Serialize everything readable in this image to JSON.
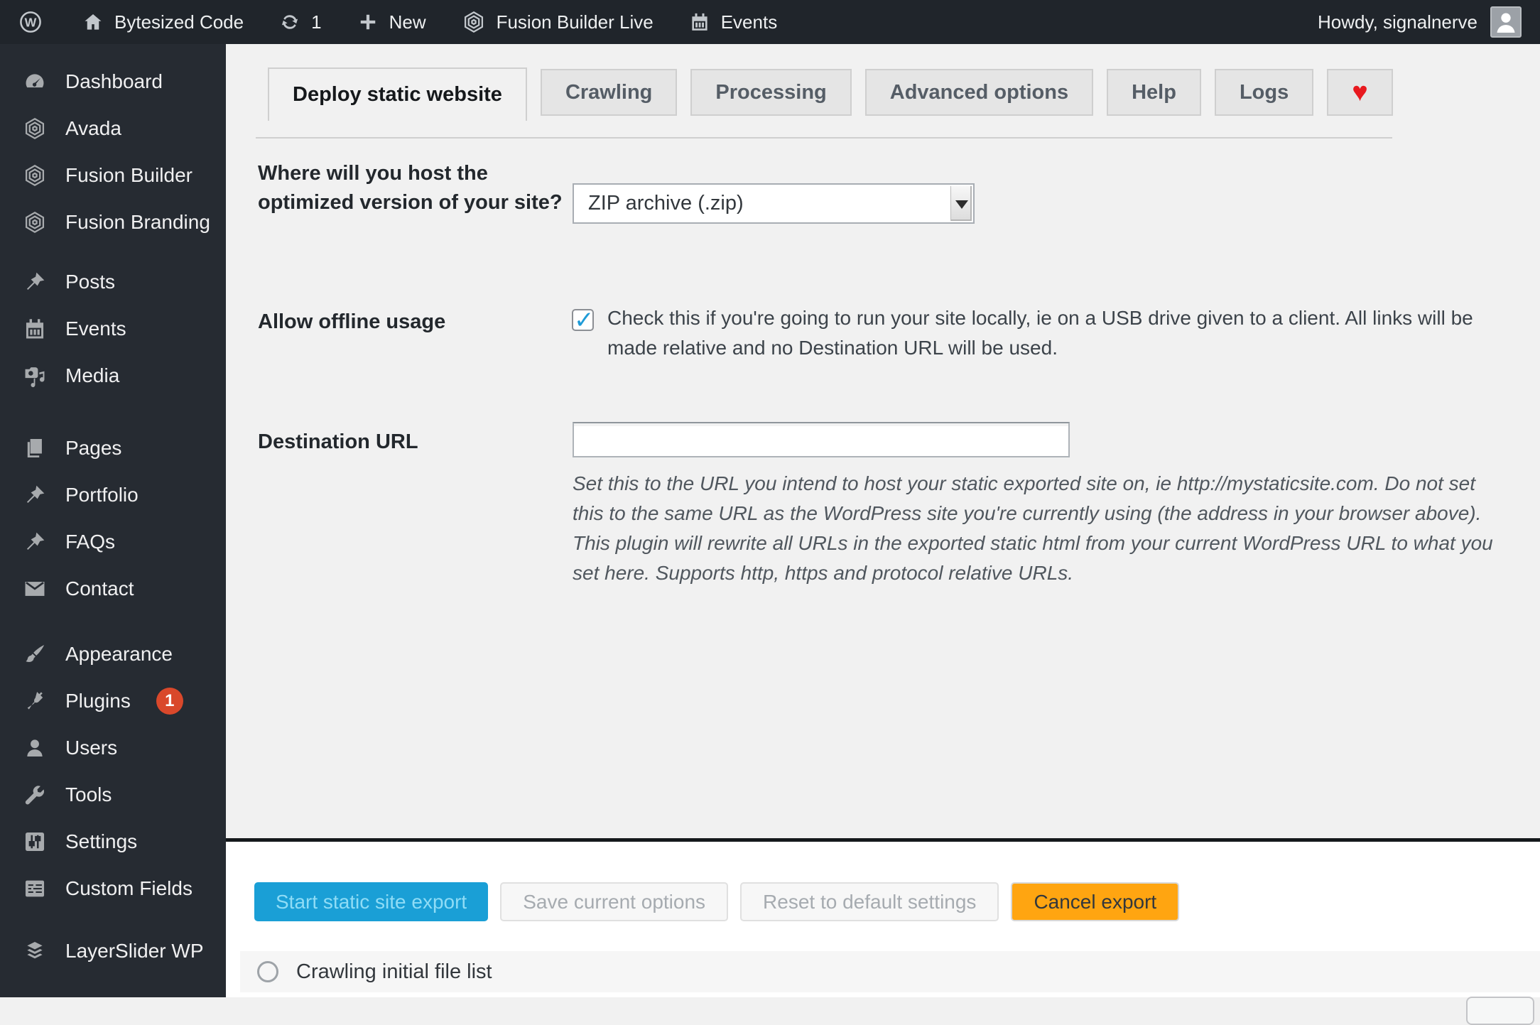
{
  "admin_bar": {
    "site_name": "Bytesized Code",
    "update_count": "1",
    "new_label": "New",
    "fusion_builder_live_label": "Fusion Builder Live",
    "events_label": "Events",
    "howdy": "Howdy, signalnerve"
  },
  "sidebar": {
    "items": [
      {
        "label": "Dashboard"
      },
      {
        "label": "Avada"
      },
      {
        "label": "Fusion Builder"
      },
      {
        "label": "Fusion Branding"
      },
      {
        "label": "Posts"
      },
      {
        "label": "Events"
      },
      {
        "label": "Media"
      },
      {
        "label": "Pages"
      },
      {
        "label": "Portfolio"
      },
      {
        "label": "FAQs"
      },
      {
        "label": "Contact"
      },
      {
        "label": "Appearance"
      },
      {
        "label": "Plugins",
        "badge": "1"
      },
      {
        "label": "Users"
      },
      {
        "label": "Tools"
      },
      {
        "label": "Settings"
      },
      {
        "label": "Custom Fields"
      },
      {
        "label": "LayerSlider WP"
      }
    ]
  },
  "tabs": {
    "deploy": "Deploy static website",
    "crawling": "Crawling",
    "processing": "Processing",
    "advanced": "Advanced options",
    "help": "Help",
    "logs": "Logs",
    "heart": "♥"
  },
  "form": {
    "host_question": {
      "label": "Where will you host the optimized version of your site?",
      "selected_option": "ZIP archive (.zip)"
    },
    "offline": {
      "label": "Allow offline usage",
      "checked": true,
      "description": "Check this if you're going to run your site locally, ie on a USB drive given to a client. All links will be made relative and no Destination URL will be used."
    },
    "destination": {
      "label": "Destination URL",
      "value": "",
      "description": "Set this to the URL you intend to host your static exported site on, ie http://mystaticsite.com. Do not set this to the same URL as the WordPress site you're currently using (the address in your browser above). This plugin will rewrite all URLs in the exported static html from your current WordPress URL to what you set here. Supports http, https and protocol relative URLs."
    }
  },
  "actions": {
    "start": "Start static site export",
    "save": "Save current options",
    "reset": "Reset to default settings",
    "cancel": "Cancel export"
  },
  "status": {
    "label": "Crawling initial file list"
  },
  "colors": {
    "primary_blue": "#1a9fd6",
    "cancel_orange": "#ffa511",
    "badge_red": "#d9482b",
    "heart_red": "#e8191f",
    "admin_dark": "#20252b",
    "sidebar_dark": "#262b32",
    "page_bg": "#f1f1f1"
  }
}
